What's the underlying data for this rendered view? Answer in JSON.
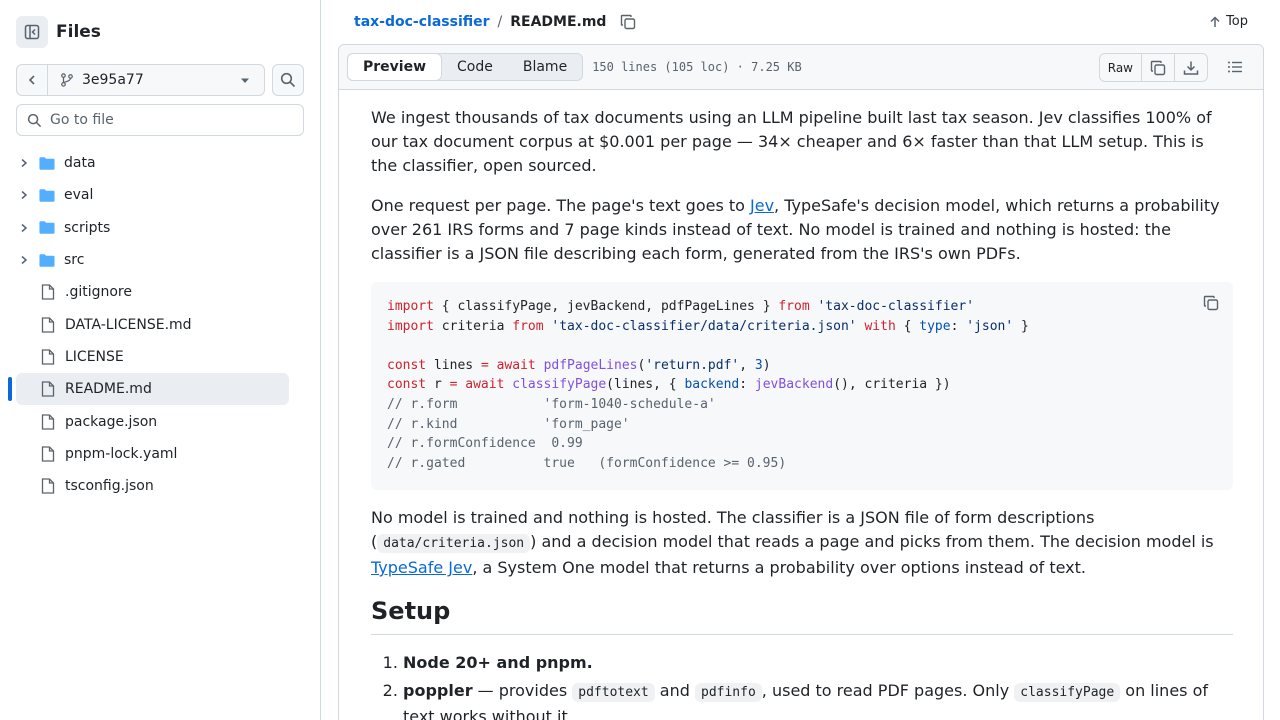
{
  "sidebar": {
    "title": "Files",
    "branch": "3e95a77",
    "goto_placeholder": "Go to file",
    "items": [
      {
        "label": "data",
        "type": "folder"
      },
      {
        "label": "eval",
        "type": "folder"
      },
      {
        "label": "scripts",
        "type": "folder"
      },
      {
        "label": "src",
        "type": "folder"
      },
      {
        "label": ".gitignore",
        "type": "file"
      },
      {
        "label": "DATA-LICENSE.md",
        "type": "file"
      },
      {
        "label": "LICENSE",
        "type": "file"
      },
      {
        "label": "README.md",
        "type": "file",
        "active": true
      },
      {
        "label": "package.json",
        "type": "file"
      },
      {
        "label": "pnpm-lock.yaml",
        "type": "file"
      },
      {
        "label": "tsconfig.json",
        "type": "file"
      }
    ]
  },
  "breadcrumb": {
    "repo": "tax-doc-classifier",
    "separator": "/",
    "file": "README.md"
  },
  "top_link": "Top",
  "file_header": {
    "tabs": [
      "Preview",
      "Code",
      "Blame"
    ],
    "active_tab": "Preview",
    "info": "150 lines (105 loc) · 7.25 KB",
    "raw_label": "Raw"
  },
  "readme": {
    "p1": "We ingest thousands of tax documents using an LLM pipeline built last tax season. Jev classifies 100% of our tax document corpus at $0.001 per page — 34× cheaper and 6× faster than that LLM setup. This is the classifier, open sourced.",
    "p2_before": "One request per page. The page's text goes to ",
    "p2_link": "Jev",
    "p2_after": ", TypeSafe's decision model, which returns a probability over 261 IRS forms and 7 page kinds instead of text. No model is trained and nothing is hosted: the classifier is a JSON file describing each form, generated from the IRS's own PDFs.",
    "p3_before": "No model is trained and nothing is hosted. The classifier is a JSON file of form descriptions (",
    "p3_code": "data/criteria.json",
    "p3_middle": ") and a decision model that reads a page and picks from them. The decision model is ",
    "p3_link": "TypeSafe Jev",
    "p3_after": ", a System One model that returns a probability over options instead of text.",
    "setup_heading": "Setup",
    "step1": "Node 20+ and pnpm.",
    "step2_bold": "poppler",
    "step2_a": " — provides ",
    "step2_code1": "pdftotext",
    "step2_b": " and ",
    "step2_code2": "pdfinfo",
    "step2_c": ", used to read PDF pages. Only ",
    "step2_code3": "classifyPage",
    "step2_d": " on lines of text works without it."
  },
  "code": {
    "l1_import": "import",
    "l1_names": " { classifyPage, jevBackend, pdfPageLines } ",
    "l1_from": "from",
    "l1_mod": "'tax-doc-classifier'",
    "l2_import": "import",
    "l2_name": " criteria ",
    "l2_from": "from",
    "l2_mod": "'tax-doc-classifier/data/criteria.json'",
    "l2_with": "with",
    "l2_open": " { ",
    "l2_type": "type",
    "l2_colon": ": ",
    "l2_json": "'json'",
    "l2_close": " }",
    "l4_const": "const",
    "l4_name": " lines ",
    "l4_eq": "=",
    "l4_await": "await",
    "l4_fn": "pdfPageLines",
    "l4_paren": "(",
    "l4_arg": "'return.pdf'",
    "l4_comma": ", ",
    "l4_num": "3",
    "l4_end": ")",
    "l5_const": "const",
    "l5_name": " r ",
    "l5_eq": "=",
    "l5_await": "await",
    "l5_fn": "classifyPage",
    "l5_mid": "(lines, { ",
    "l5_backend": "backend",
    "l5_colon": ": ",
    "l5_fn2": "jevBackend",
    "l5_end": "(), criteria })",
    "c1": "// r.form           'form-1040-schedule-a'",
    "c2": "// r.kind           'form_page'",
    "c3": "// r.formConfidence  0.99",
    "c4": "// r.gated          true   (formConfidence >= 0.95)"
  }
}
